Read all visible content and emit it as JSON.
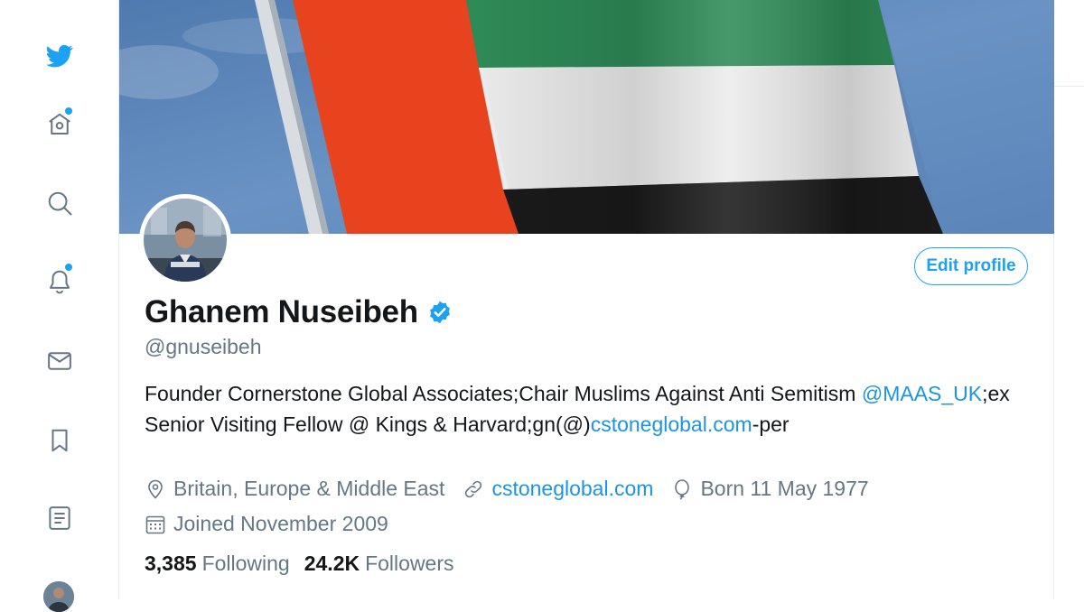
{
  "colors": {
    "accent": "#1da1f2",
    "link": "#1b95e0",
    "secondary_text": "#657786",
    "primary_text": "#14171a",
    "flag_red": "#e8431f",
    "flag_green": "#2e8b57",
    "flag_white": "#ececec",
    "flag_black": "#1a1a1a",
    "sky": "#5f86b6"
  },
  "nav": {
    "items": [
      {
        "icon": "twitter-bird-icon"
      },
      {
        "icon": "home-icon",
        "has_dot": true
      },
      {
        "icon": "search-icon"
      },
      {
        "icon": "notifications-bell-icon",
        "has_dot": true
      },
      {
        "icon": "messages-envelope-icon"
      },
      {
        "icon": "bookmark-icon"
      },
      {
        "icon": "lists-icon"
      },
      {
        "icon": "profile-avatar"
      }
    ]
  },
  "profile": {
    "edit_label": "Edit profile",
    "name": "Ghanem Nuseibeh",
    "verified": true,
    "handle": "@gnuseibeh",
    "bio": {
      "part1": "Founder Cornerstone Global Associates;Chair Muslims Against Anti Semitism ",
      "mention": "@MAAS_UK",
      "part2": ";ex Senior Visiting Fellow @ Kings & Harvard;gn(@)",
      "link": "cstoneglobal.com",
      "part3": "-per"
    },
    "location": "Britain, Europe & Middle East",
    "website": "cstoneglobal.com",
    "birthday": "Born 11 May 1977",
    "joined": "Joined November 2009",
    "following_count": "3,385",
    "following_label": "Following",
    "followers_count": "24.2K",
    "followers_label": "Followers"
  }
}
